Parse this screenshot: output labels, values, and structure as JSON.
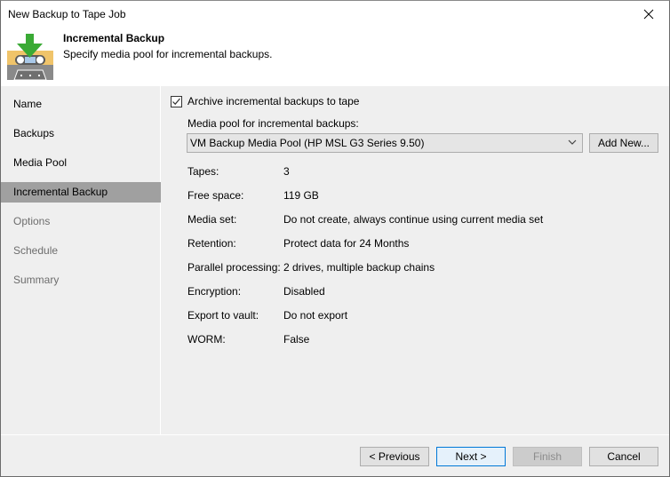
{
  "window": {
    "title": "New Backup to Tape Job",
    "close_icon": "close-icon"
  },
  "header": {
    "icon": "tape-download-icon",
    "title": "Incremental Backup",
    "subtitle": "Specify media pool for incremental backups."
  },
  "sidebar": {
    "items": [
      {
        "label": "Name",
        "state": "enabled"
      },
      {
        "label": "Backups",
        "state": "enabled"
      },
      {
        "label": "Media Pool",
        "state": "enabled"
      },
      {
        "label": "Incremental Backup",
        "state": "active"
      },
      {
        "label": "Options",
        "state": "disabled"
      },
      {
        "label": "Schedule",
        "state": "disabled"
      },
      {
        "label": "Summary",
        "state": "disabled"
      }
    ]
  },
  "content": {
    "archive_checkbox": {
      "label": "Archive incremental backups to tape",
      "checked": true
    },
    "media_pool_label": "Media pool for incremental backups:",
    "media_pool_selected": "VM Backup Media Pool (HP MSL G3 Series 9.50)",
    "add_new_label": "Add New...",
    "info": [
      {
        "label": "Tapes:",
        "value": "3"
      },
      {
        "label": "Free space:",
        "value": "119 GB"
      },
      {
        "label": "Media set:",
        "value": "Do not create, always continue using current media set"
      },
      {
        "label": "Retention:",
        "value": "Protect data for 24 Months"
      },
      {
        "label": "Parallel processing:",
        "value": "2 drives, multiple backup chains"
      },
      {
        "label": "Encryption:",
        "value": "Disabled"
      },
      {
        "label": "Export to vault:",
        "value": "Do not export"
      },
      {
        "label": "WORM:",
        "value": "False"
      }
    ]
  },
  "footer": {
    "previous_label": "< Previous",
    "next_label": "Next >",
    "finish_label": "Finish",
    "cancel_label": "Cancel"
  },
  "colors": {
    "sidebar_active": "#a0a0a0",
    "panel_bg": "#efefef",
    "default_button_border": "#0078d7",
    "arrow_green": "#3aaa35",
    "tape_yellow": "#f0c46a"
  }
}
